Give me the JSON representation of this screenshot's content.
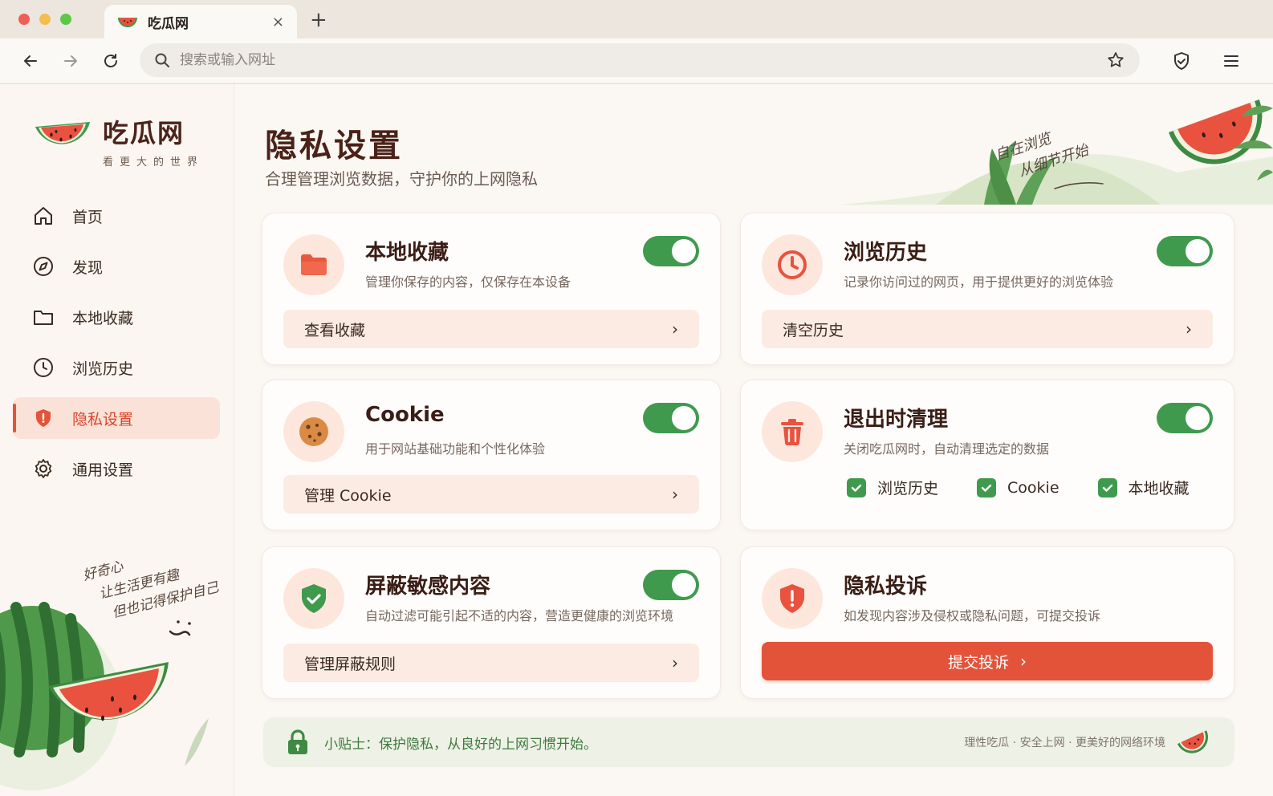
{
  "browser": {
    "tab_title": "吃瓜网",
    "tab_close": "×",
    "new_tab": "+",
    "url_placeholder": "搜索或输入网址"
  },
  "sidebar": {
    "brand_name": "吃瓜网",
    "brand_tagline": "看更大的世界",
    "items": [
      {
        "label": "首页",
        "icon": "home-icon"
      },
      {
        "label": "发现",
        "icon": "compass-icon"
      },
      {
        "label": "本地收藏",
        "icon": "folder-icon"
      },
      {
        "label": "浏览历史",
        "icon": "clock-icon"
      },
      {
        "label": "隐私设置",
        "icon": "shield-icon",
        "active": true
      },
      {
        "label": "通用设置",
        "icon": "gear-icon"
      }
    ],
    "quote": [
      "好奇心",
      "让生活更有趣",
      "但也记得保护自己"
    ]
  },
  "page": {
    "title": "隐私设置",
    "subtitle": "合理管理浏览数据，守护你的上网隐私",
    "hero_note": [
      "自在浏览",
      "从细节开始"
    ]
  },
  "cards": {
    "favorites": {
      "title": "本地收藏",
      "desc": "管理你保存的内容，仅保存在本设备",
      "action": "查看收藏",
      "enabled": true
    },
    "history": {
      "title": "浏览历史",
      "desc": "记录你访问过的网页，用于提供更好的浏览体验",
      "action": "清空历史",
      "enabled": true
    },
    "cookie": {
      "title": "Cookie",
      "desc": "用于网站基础功能和个性化体验",
      "action": "管理 Cookie",
      "enabled": true
    },
    "exit_clean": {
      "title": "退出时清理",
      "desc": "关闭吃瓜网时，自动清理选定的数据",
      "enabled": true,
      "options": [
        {
          "label": "浏览历史",
          "checked": true
        },
        {
          "label": "Cookie",
          "checked": true
        },
        {
          "label": "本地收藏",
          "checked": true
        }
      ]
    },
    "block": {
      "title": "屏蔽敏感内容",
      "desc": "自动过滤可能引起不适的内容，营造更健康的浏览环境",
      "action": "管理屏蔽规则",
      "enabled": true
    },
    "report": {
      "title": "隐私投诉",
      "desc": "如发现内容涉及侵权或隐私问题，可提交投诉",
      "action": "提交投诉"
    }
  },
  "tip": {
    "text": "小贴士：保护隐私，从良好的上网习惯开始。",
    "right": "理性吃瓜 · 安全上网 · 更美好的网络环境"
  },
  "colors": {
    "accent": "#e3533a",
    "toggle_on": "#3f9a4e",
    "brand_dark": "#4a241b"
  }
}
